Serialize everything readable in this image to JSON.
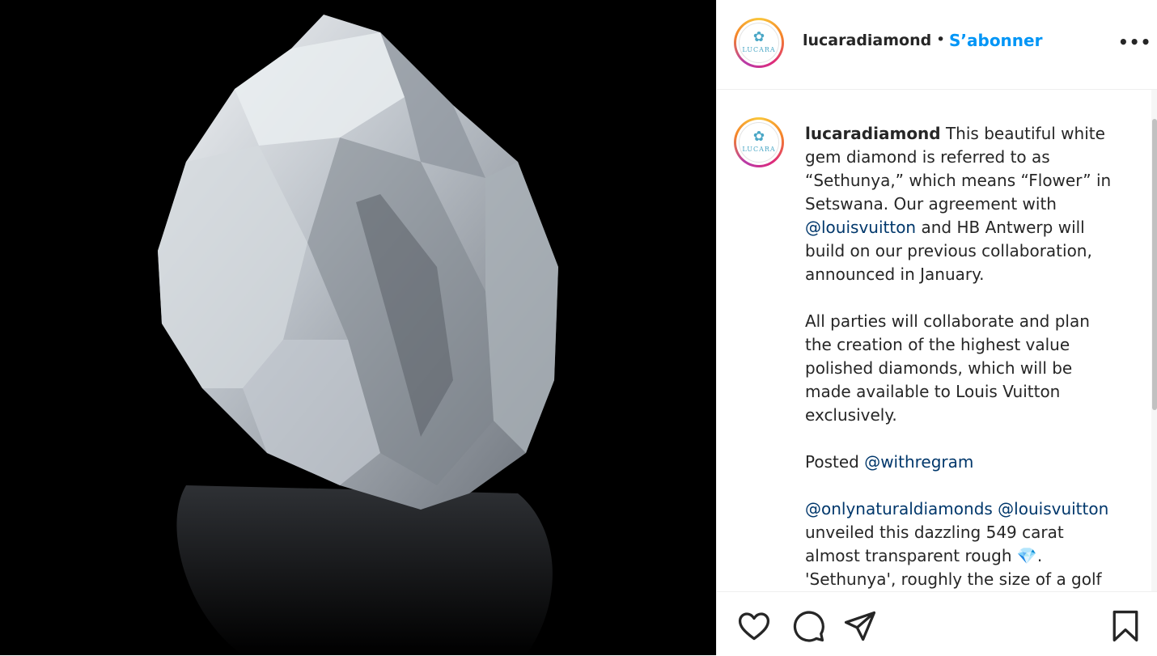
{
  "post": {
    "username": "lucaradiamond",
    "separator": "•",
    "follow_label": "S’abonner",
    "more_label": "•••",
    "avatar_logo_text": "LUCARA",
    "image_alt": "Large rough white diamond on black reflective background"
  },
  "caption": {
    "username": "lucaradiamond",
    "p1_a": " This beautiful white gem diamond is referred to as “Sethunya,” which means “Flower” in Setswana. Our agreement with ",
    "mention_1": "@louisvuitton",
    "p1_b": " and HB Antwerp will build on our previous collaboration, announced in January.\n\nAll parties will collaborate and plan the creation of the highest value polished diamonds, which will be made available to Louis Vuitton exclusively.\n\nPosted ",
    "mention_2": "@withregram",
    "p2_gap": "\n\n",
    "mention_3": "@onlynaturaldiamonds",
    "p3_space": " ",
    "mention_4": "@louisvuitton",
    "p3_a": " unveiled this dazzling 549 carat almost transparent rough ",
    "emoji": "💎",
    "p3_b": ". 'Sethunya', roughly the size of a golf"
  },
  "actions": {
    "like_icon": "heart-icon",
    "comment_icon": "comment-icon",
    "share_icon": "share-icon",
    "save_icon": "bookmark-icon"
  }
}
